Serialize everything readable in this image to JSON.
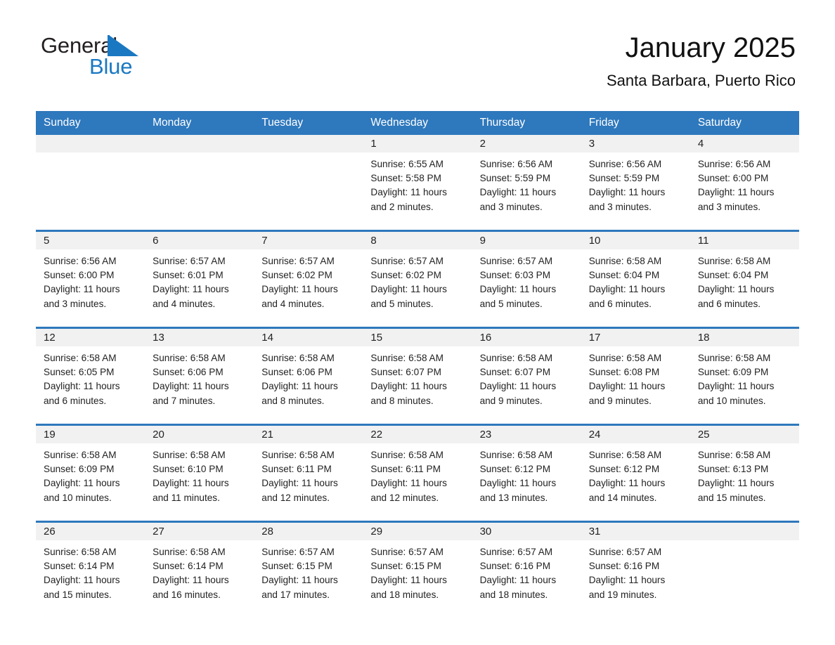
{
  "brand": {
    "name_part1": "General",
    "name_part2": "Blue",
    "triangle_icon": "triangle-logo-icon",
    "accent_color": "#1a78c2"
  },
  "header": {
    "title": "January 2025",
    "location": "Santa Barbara, Puerto Rico"
  },
  "theme": {
    "header_blue": "#2e78bd",
    "day_band_gray": "#f1f1f1",
    "text_color": "#222222"
  },
  "weekdays": [
    "Sunday",
    "Monday",
    "Tuesday",
    "Wednesday",
    "Thursday",
    "Friday",
    "Saturday"
  ],
  "weeks": [
    [
      {
        "day": "",
        "lines": []
      },
      {
        "day": "",
        "lines": []
      },
      {
        "day": "",
        "lines": []
      },
      {
        "day": "1",
        "lines": [
          "Sunrise: 6:55 AM",
          "Sunset: 5:58 PM",
          "Daylight: 11 hours",
          "and 2 minutes."
        ]
      },
      {
        "day": "2",
        "lines": [
          "Sunrise: 6:56 AM",
          "Sunset: 5:59 PM",
          "Daylight: 11 hours",
          "and 3 minutes."
        ]
      },
      {
        "day": "3",
        "lines": [
          "Sunrise: 6:56 AM",
          "Sunset: 5:59 PM",
          "Daylight: 11 hours",
          "and 3 minutes."
        ]
      },
      {
        "day": "4",
        "lines": [
          "Sunrise: 6:56 AM",
          "Sunset: 6:00 PM",
          "Daylight: 11 hours",
          "and 3 minutes."
        ]
      }
    ],
    [
      {
        "day": "5",
        "lines": [
          "Sunrise: 6:56 AM",
          "Sunset: 6:00 PM",
          "Daylight: 11 hours",
          "and 3 minutes."
        ]
      },
      {
        "day": "6",
        "lines": [
          "Sunrise: 6:57 AM",
          "Sunset: 6:01 PM",
          "Daylight: 11 hours",
          "and 4 minutes."
        ]
      },
      {
        "day": "7",
        "lines": [
          "Sunrise: 6:57 AM",
          "Sunset: 6:02 PM",
          "Daylight: 11 hours",
          "and 4 minutes."
        ]
      },
      {
        "day": "8",
        "lines": [
          "Sunrise: 6:57 AM",
          "Sunset: 6:02 PM",
          "Daylight: 11 hours",
          "and 5 minutes."
        ]
      },
      {
        "day": "9",
        "lines": [
          "Sunrise: 6:57 AM",
          "Sunset: 6:03 PM",
          "Daylight: 11 hours",
          "and 5 minutes."
        ]
      },
      {
        "day": "10",
        "lines": [
          "Sunrise: 6:58 AM",
          "Sunset: 6:04 PM",
          "Daylight: 11 hours",
          "and 6 minutes."
        ]
      },
      {
        "day": "11",
        "lines": [
          "Sunrise: 6:58 AM",
          "Sunset: 6:04 PM",
          "Daylight: 11 hours",
          "and 6 minutes."
        ]
      }
    ],
    [
      {
        "day": "12",
        "lines": [
          "Sunrise: 6:58 AM",
          "Sunset: 6:05 PM",
          "Daylight: 11 hours",
          "and 6 minutes."
        ]
      },
      {
        "day": "13",
        "lines": [
          "Sunrise: 6:58 AM",
          "Sunset: 6:06 PM",
          "Daylight: 11 hours",
          "and 7 minutes."
        ]
      },
      {
        "day": "14",
        "lines": [
          "Sunrise: 6:58 AM",
          "Sunset: 6:06 PM",
          "Daylight: 11 hours",
          "and 8 minutes."
        ]
      },
      {
        "day": "15",
        "lines": [
          "Sunrise: 6:58 AM",
          "Sunset: 6:07 PM",
          "Daylight: 11 hours",
          "and 8 minutes."
        ]
      },
      {
        "day": "16",
        "lines": [
          "Sunrise: 6:58 AM",
          "Sunset: 6:07 PM",
          "Daylight: 11 hours",
          "and 9 minutes."
        ]
      },
      {
        "day": "17",
        "lines": [
          "Sunrise: 6:58 AM",
          "Sunset: 6:08 PM",
          "Daylight: 11 hours",
          "and 9 minutes."
        ]
      },
      {
        "day": "18",
        "lines": [
          "Sunrise: 6:58 AM",
          "Sunset: 6:09 PM",
          "Daylight: 11 hours",
          "and 10 minutes."
        ]
      }
    ],
    [
      {
        "day": "19",
        "lines": [
          "Sunrise: 6:58 AM",
          "Sunset: 6:09 PM",
          "Daylight: 11 hours",
          "and 10 minutes."
        ]
      },
      {
        "day": "20",
        "lines": [
          "Sunrise: 6:58 AM",
          "Sunset: 6:10 PM",
          "Daylight: 11 hours",
          "and 11 minutes."
        ]
      },
      {
        "day": "21",
        "lines": [
          "Sunrise: 6:58 AM",
          "Sunset: 6:11 PM",
          "Daylight: 11 hours",
          "and 12 minutes."
        ]
      },
      {
        "day": "22",
        "lines": [
          "Sunrise: 6:58 AM",
          "Sunset: 6:11 PM",
          "Daylight: 11 hours",
          "and 12 minutes."
        ]
      },
      {
        "day": "23",
        "lines": [
          "Sunrise: 6:58 AM",
          "Sunset: 6:12 PM",
          "Daylight: 11 hours",
          "and 13 minutes."
        ]
      },
      {
        "day": "24",
        "lines": [
          "Sunrise: 6:58 AM",
          "Sunset: 6:12 PM",
          "Daylight: 11 hours",
          "and 14 minutes."
        ]
      },
      {
        "day": "25",
        "lines": [
          "Sunrise: 6:58 AM",
          "Sunset: 6:13 PM",
          "Daylight: 11 hours",
          "and 15 minutes."
        ]
      }
    ],
    [
      {
        "day": "26",
        "lines": [
          "Sunrise: 6:58 AM",
          "Sunset: 6:14 PM",
          "Daylight: 11 hours",
          "and 15 minutes."
        ]
      },
      {
        "day": "27",
        "lines": [
          "Sunrise: 6:58 AM",
          "Sunset: 6:14 PM",
          "Daylight: 11 hours",
          "and 16 minutes."
        ]
      },
      {
        "day": "28",
        "lines": [
          "Sunrise: 6:57 AM",
          "Sunset: 6:15 PM",
          "Daylight: 11 hours",
          "and 17 minutes."
        ]
      },
      {
        "day": "29",
        "lines": [
          "Sunrise: 6:57 AM",
          "Sunset: 6:15 PM",
          "Daylight: 11 hours",
          "and 18 minutes."
        ]
      },
      {
        "day": "30",
        "lines": [
          "Sunrise: 6:57 AM",
          "Sunset: 6:16 PM",
          "Daylight: 11 hours",
          "and 18 minutes."
        ]
      },
      {
        "day": "31",
        "lines": [
          "Sunrise: 6:57 AM",
          "Sunset: 6:16 PM",
          "Daylight: 11 hours",
          "and 19 minutes."
        ]
      },
      {
        "day": "",
        "lines": []
      }
    ]
  ]
}
